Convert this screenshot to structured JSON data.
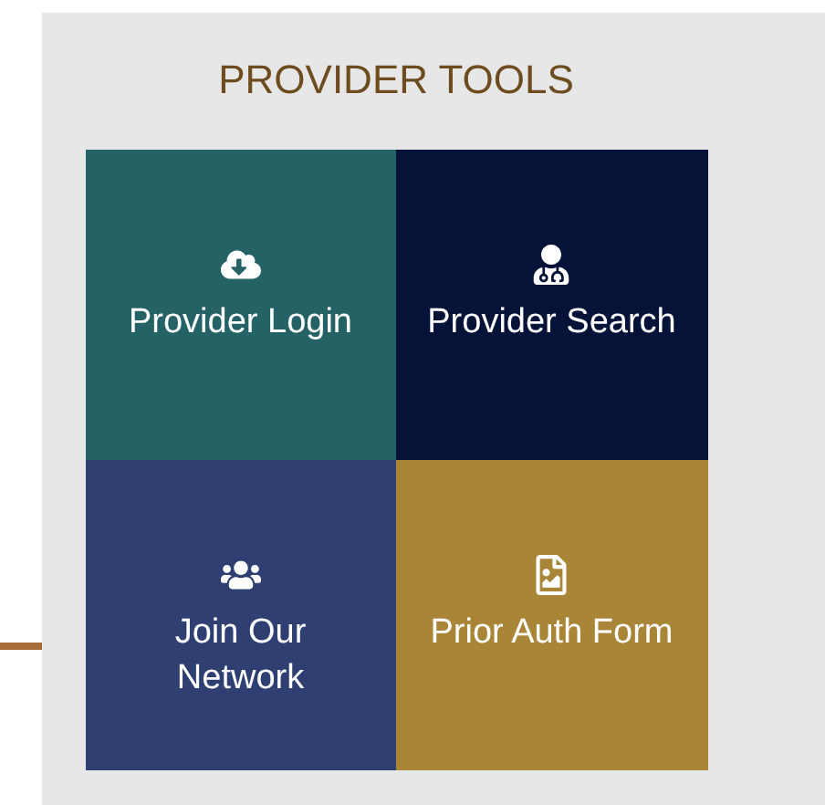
{
  "title": "PROVIDER TOOLS",
  "tiles": [
    {
      "label": "Provider Login",
      "color": "#256266"
    },
    {
      "label": "Provider Search",
      "color": "#061338"
    },
    {
      "label": "Join Our\nNetwork",
      "color": "#2f3f71"
    },
    {
      "label": "Prior Auth Form",
      "color": "#a98537"
    }
  ]
}
